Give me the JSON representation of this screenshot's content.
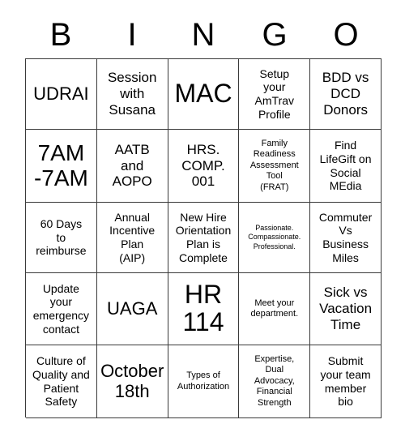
{
  "card": {
    "title": "BINGO",
    "header_letters": [
      "B",
      "I",
      "N",
      "G",
      "O"
    ],
    "columns": 5,
    "rows": 5,
    "colors": {
      "background": "#ffffff",
      "grid_line": "#3a3a3a",
      "text": "#000000"
    },
    "cells": [
      {
        "text": "UDRAI",
        "size": "fs-lg"
      },
      {
        "text": "Session\nwith\nSusana",
        "size": "fs-md"
      },
      {
        "text": "MAC",
        "size": "fs-xxl"
      },
      {
        "text": "Setup\nyour\nAmTrav\nProfile",
        "size": "fs-sm"
      },
      {
        "text": "BDD vs\nDCD\nDonors",
        "size": "fs-md"
      },
      {
        "text": "7AM\n-7AM",
        "size": "fs-xl"
      },
      {
        "text": "AATB\nand\nAOPO",
        "size": "fs-md"
      },
      {
        "text": "HRS.\nCOMP.\n001",
        "size": "fs-md"
      },
      {
        "text": "Family\nReadiness\nAssessment\nTool\n(FRAT)",
        "size": "fs-xs"
      },
      {
        "text": "Find\nLifeGift on\nSocial\nMEdia",
        "size": "fs-sm"
      },
      {
        "text": "60 Days\nto\nreimburse",
        "size": "fs-sm"
      },
      {
        "text": "Annual\nIncentive\nPlan\n(AIP)",
        "size": "fs-sm"
      },
      {
        "text": "New Hire\nOrientation\nPlan is\nComplete",
        "size": "fs-sm"
      },
      {
        "text": "Passionate.\nCompassionate.\nProfessional.",
        "size": "fs-xxs"
      },
      {
        "text": "Commuter\nVs\nBusiness\nMiles",
        "size": "fs-sm"
      },
      {
        "text": "Update\nyour\nemergency\ncontact",
        "size": "fs-sm"
      },
      {
        "text": "UAGA",
        "size": "fs-lg"
      },
      {
        "text": "HR\n114",
        "size": "fs-xxl"
      },
      {
        "text": "Meet your\ndepartment.",
        "size": "fs-xs"
      },
      {
        "text": "Sick vs\nVacation\nTime",
        "size": "fs-md"
      },
      {
        "text": "Culture of\nQuality and\nPatient\nSafety",
        "size": "fs-sm"
      },
      {
        "text": "October\n18th",
        "size": "fs-lg"
      },
      {
        "text": "Types of\nAuthorization",
        "size": "fs-xs"
      },
      {
        "text": "Expertise,\nDual\nAdvocacy,\nFinancial\nStrength",
        "size": "fs-xs"
      },
      {
        "text": "Submit\nyour team\nmember\nbio",
        "size": "fs-sm"
      }
    ]
  }
}
